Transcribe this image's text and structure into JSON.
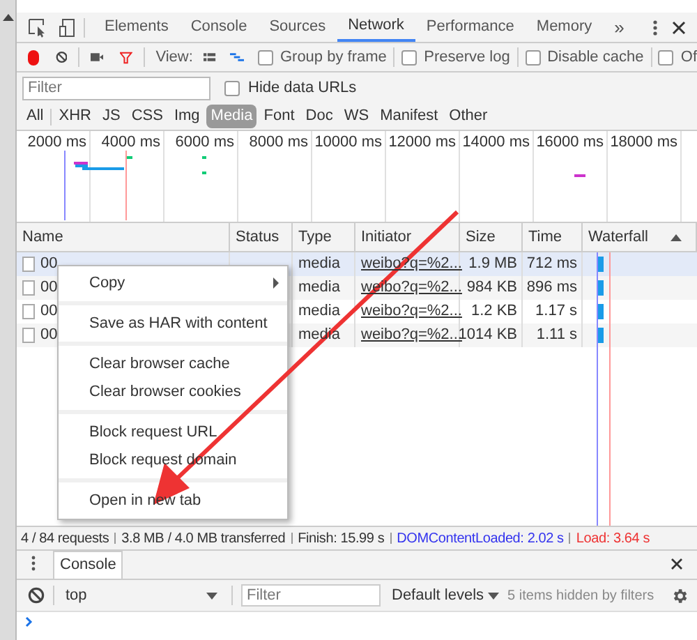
{
  "tabs": [
    {
      "label": "Elements",
      "selected": false
    },
    {
      "label": "Console",
      "selected": false
    },
    {
      "label": "Sources",
      "selected": false
    },
    {
      "label": "Network",
      "selected": true
    },
    {
      "label": "Performance",
      "selected": false
    },
    {
      "label": "Memory",
      "selected": false
    }
  ],
  "more_tabs": "»",
  "toolbar": {
    "view_label": "View:",
    "checkboxes": [
      {
        "label": "Group by frame",
        "checked": false
      },
      {
        "label": "Preserve log",
        "checked": false
      },
      {
        "label": "Disable cache",
        "checked": false
      },
      {
        "label": "Of",
        "checked": false
      }
    ]
  },
  "filter": {
    "placeholder": "Filter",
    "hide_data_urls": {
      "label": "Hide data URLs",
      "checked": false
    }
  },
  "type_filters": [
    {
      "label": "All",
      "selected": false
    },
    {
      "label": "XHR",
      "selected": false
    },
    {
      "label": "JS",
      "selected": false
    },
    {
      "label": "CSS",
      "selected": false
    },
    {
      "label": "Img",
      "selected": false
    },
    {
      "label": "Media",
      "selected": true
    },
    {
      "label": "Font",
      "selected": false
    },
    {
      "label": "Doc",
      "selected": false
    },
    {
      "label": "WS",
      "selected": false
    },
    {
      "label": "Manifest",
      "selected": false
    },
    {
      "label": "Other",
      "selected": false
    }
  ],
  "timeline_ticks": [
    "2000 ms",
    "4000 ms",
    "6000 ms",
    "8000 ms",
    "10000 ms",
    "12000 ms",
    "14000 ms",
    "16000 ms",
    "18000 ms"
  ],
  "table": {
    "columns": [
      "Name",
      "Status",
      "Type",
      "Initiator",
      "Size",
      "Time",
      "Waterfall"
    ],
    "rows": [
      {
        "name": "00",
        "type": "media",
        "initiator": "weibo?q=%2...",
        "size": "1.9 MB",
        "time": "712 ms",
        "selected": true
      },
      {
        "name": "00",
        "type": "media",
        "initiator": "weibo?q=%2...",
        "size": "984 KB",
        "time": "896 ms",
        "selected": false
      },
      {
        "name": "00",
        "type": "media",
        "initiator": "weibo?q=%2...",
        "size": "1.2 KB",
        "time": "1.17 s",
        "selected": false
      },
      {
        "name": "00",
        "type": "media",
        "initiator": "weibo?q=%2...",
        "size": "1014 KB",
        "time": "1.11 s",
        "selected": false
      }
    ]
  },
  "context_menu": [
    [
      {
        "label": "Copy",
        "submenu": true
      }
    ],
    [
      {
        "label": "Save as HAR with content",
        "submenu": false
      }
    ],
    [
      {
        "label": "Clear browser cache",
        "submenu": false
      },
      {
        "label": "Clear browser cookies",
        "submenu": false
      }
    ],
    [
      {
        "label": "Block request URL",
        "submenu": false
      },
      {
        "label": "Block request domain",
        "submenu": false
      }
    ],
    [
      {
        "label": "Open in new tab",
        "submenu": false
      }
    ]
  ],
  "status_bar": [
    {
      "text": "4 / 84 requests",
      "color": "#333333"
    },
    {
      "text": "3.8 MB / 4.0 MB transferred",
      "color": "#333333"
    },
    {
      "text": "Finish: 15.99 s",
      "color": "#333333"
    },
    {
      "text": "DOMContentLoaded: 2.02 s",
      "color": "#3333ee"
    },
    {
      "text": "Load: 3.64 s",
      "color": "#ee3333"
    }
  ],
  "drawer": {
    "tab": "Console",
    "context": "top",
    "filter_placeholder": "Filter",
    "levels": "Default levels",
    "hidden": "5 items hidden by filters"
  }
}
